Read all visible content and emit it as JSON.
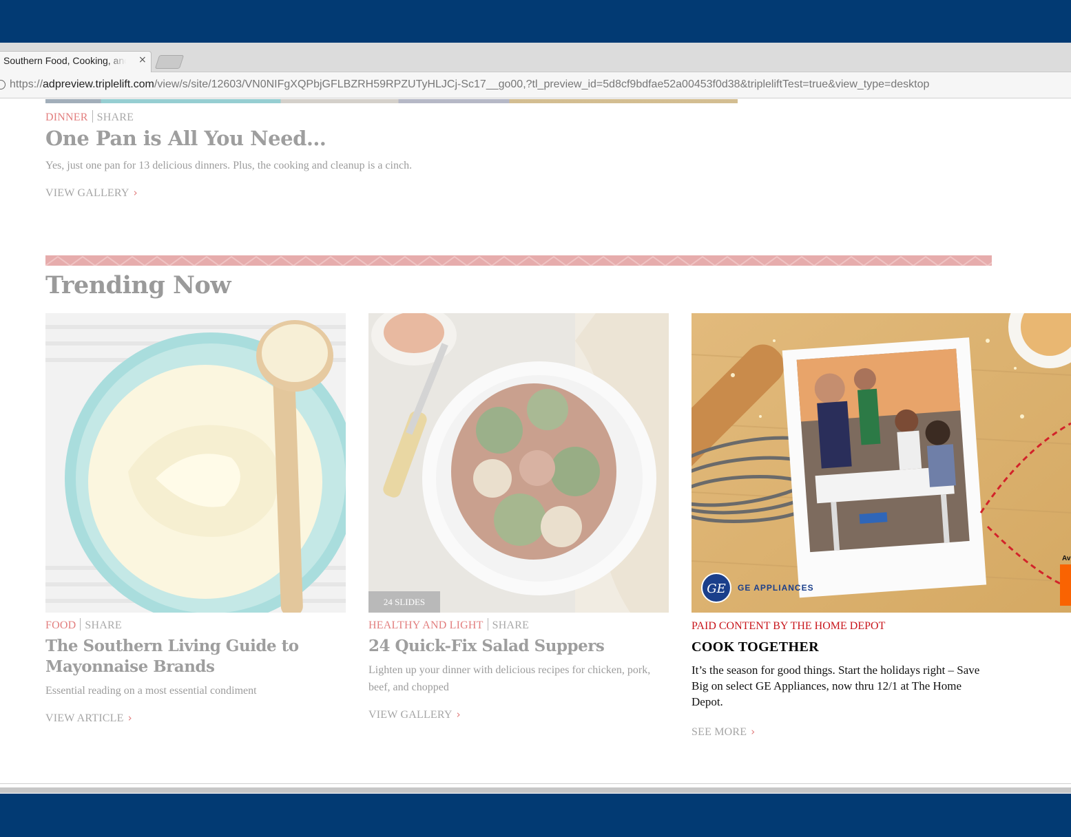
{
  "browser": {
    "tab_title": "Southern Food, Cooking, and Recipes",
    "tab_close": "×",
    "url_scheme": "https://",
    "url_host": "adpreview.triplelift.com",
    "url_path": "/view/s/site/12603/VN0NIFgXQPbjGFLBZRH59RPZUTyHLJCj-Sc17__go00,?tl_preview_id=5d8cf9bdfae52a00453f0d38&tripleliftTest=true&view_type=desktop"
  },
  "top_article": {
    "category": "DINNER",
    "share": "SHARE",
    "title": "One Pan is All You Need…",
    "description": "Yes, just one pan for 13 delicious dinners. Plus, the cooking and cleanup is a cinch.",
    "cta": "VIEW GALLERY"
  },
  "section_title": "Trending Now",
  "cards": [
    {
      "category": "FOOD",
      "share": "SHARE",
      "title": "The Southern Living Guide to Mayonnaise Brands",
      "description": "Essential reading on a most essential condiment",
      "cta": "VIEW ARTICLE"
    },
    {
      "category": "HEALTHY AND LIGHT",
      "share": "SHARE",
      "title": "24 Quick-Fix Salad Suppers",
      "description": "Lighten up your dinner with delicious recipes for chicken, pork, beef, and chopped",
      "cta": "VIEW GALLERY",
      "badge": "24 SLIDES"
    }
  ],
  "ad": {
    "sponsor_label": "PAID CONTENT BY THE HOME DEPOT",
    "title": "COOK TOGETHER",
    "description": "It’s the season for good things. Start the holidays right – Save Big on select GE Appliances, now thru 12/1 at The Home Depot.",
    "cta": "SEE MORE",
    "brand_text": "GE APPLIANCES",
    "logo_monogram": "GE",
    "corner_text": "Av"
  },
  "colors": {
    "frame_navy": "#023a73",
    "category_pink": "#e27e7e",
    "divider_pink": "#e6acac",
    "ad_red": "#c8151b",
    "home_depot_orange": "#f96302"
  },
  "icons": [
    "close-icon",
    "info-icon",
    "chevron-right-icon"
  ]
}
